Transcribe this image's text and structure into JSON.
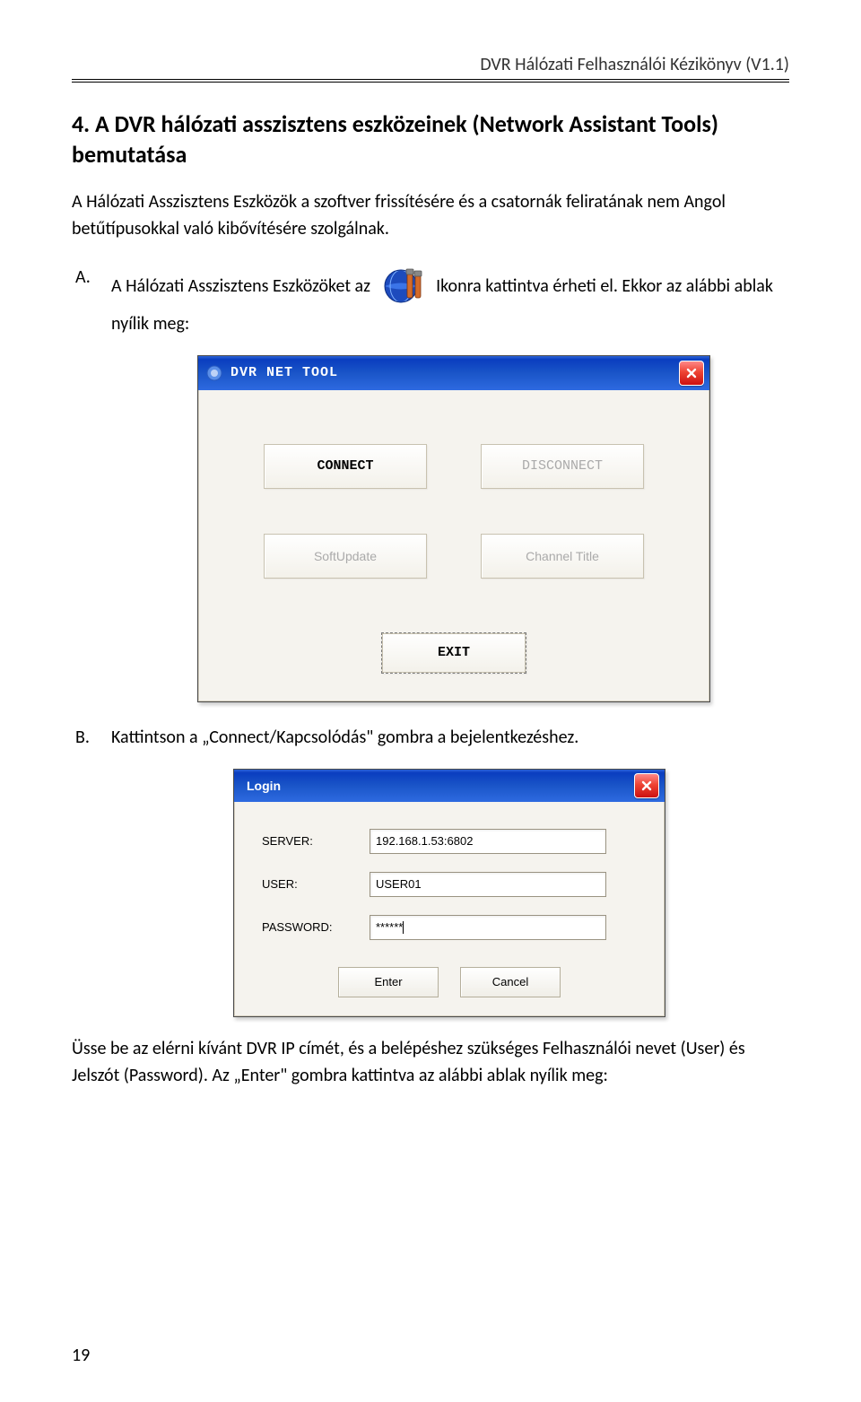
{
  "header": {
    "doc_title": "DVR Hálózati Felhasználói Kézikönyv (V1.1)"
  },
  "section": {
    "title": "4. A DVR hálózati asszisztens eszközeinek (Network Assistant Tools) bemutatása",
    "intro": "A Hálózati Asszisztens Eszközök a szoftver frissítésére és a csatornák feliratának nem Angol betűtípusokkal való kibővítésére szolgálnak."
  },
  "items": {
    "a": {
      "letter": "A.",
      "pre_icon_text": "A Hálózati Asszisztens Eszközöket az ",
      "post_icon_text": " Ikonra kattintva érheti el. Ekkor az alábbi ablak nyílik meg:"
    },
    "b": {
      "letter": "B.",
      "text": "Kattintson a „Connect/Kapcsolódás\" gombra a bejelentkezéshez."
    }
  },
  "dvr_tool": {
    "title": "DVR NET TOOL",
    "buttons": {
      "connect": "CONNECT",
      "disconnect": "DISCONNECT",
      "softupdate": "SoftUpdate",
      "channel_title": "Channel Title",
      "exit": "EXIT"
    }
  },
  "login_dialog": {
    "title": "Login",
    "labels": {
      "server": "SERVER:",
      "user": "USER:",
      "password": "PASSWORD:"
    },
    "values": {
      "server": "192.168.1.53:6802",
      "user": "USER01",
      "password": "******"
    },
    "buttons": {
      "enter": "Enter",
      "cancel": "Cancel"
    }
  },
  "closing_text": "Üsse be az elérni kívánt DVR IP címét, és a belépéshez szükséges Felhasználói nevet (User) és Jelszót (Password). Az „Enter\" gombra kattintva az alábbi ablak nyílik meg:",
  "page_number": "19"
}
